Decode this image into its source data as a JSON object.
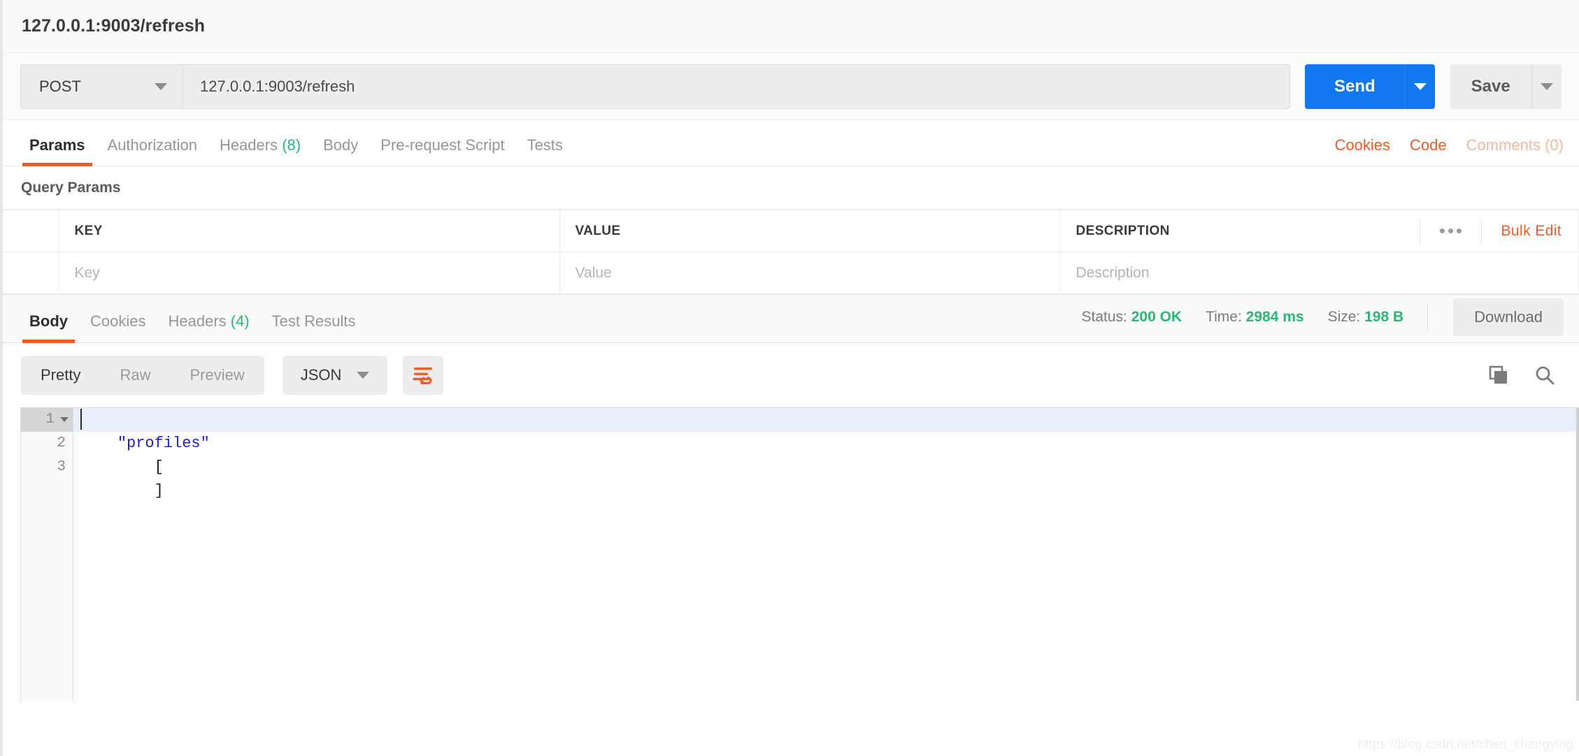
{
  "window": {
    "title": "127.0.0.1:9003/refresh"
  },
  "request_bar": {
    "method": "POST",
    "url": "127.0.0.1:9003/refresh",
    "send_label": "Send",
    "save_label": "Save"
  },
  "request_tabs": {
    "items": [
      {
        "label": "Params",
        "count": "",
        "active": true
      },
      {
        "label": "Authorization",
        "count": "",
        "active": false
      },
      {
        "label": "Headers",
        "count": "(8)",
        "active": false
      },
      {
        "label": "Body",
        "count": "",
        "active": false
      },
      {
        "label": "Pre-request Script",
        "count": "",
        "active": false
      },
      {
        "label": "Tests",
        "count": "",
        "active": false
      }
    ],
    "right_links": [
      {
        "label": "Cookies",
        "muted": false
      },
      {
        "label": "Code",
        "muted": false
      },
      {
        "label": "Comments (0)",
        "muted": true
      }
    ]
  },
  "query_params": {
    "section_title": "Query Params",
    "columns": [
      "KEY",
      "VALUE",
      "DESCRIPTION"
    ],
    "more_menu": "more-options",
    "bulk_edit_label": "Bulk Edit",
    "rows": [
      {
        "key_placeholder": "Key",
        "value_placeholder": "Value",
        "description_placeholder": "Description"
      }
    ]
  },
  "response_tabs": {
    "items": [
      {
        "label": "Body",
        "count": "",
        "active": true
      },
      {
        "label": "Cookies",
        "count": "",
        "active": false
      },
      {
        "label": "Headers",
        "count": "(4)",
        "active": false
      },
      {
        "label": "Test Results",
        "count": "",
        "active": false
      }
    ],
    "meta": {
      "status_label": "Status:",
      "status_value": "200 OK",
      "time_label": "Time:",
      "time_value": "2984 ms",
      "size_label": "Size:",
      "size_value": "198 B"
    },
    "download_label": "Download"
  },
  "body_toolbar": {
    "view_modes": [
      {
        "label": "Pretty",
        "active": true
      },
      {
        "label": "Raw",
        "active": false
      },
      {
        "label": "Preview",
        "active": false
      }
    ],
    "format": "JSON",
    "wrap_icon": "word-wrap-icon",
    "copy_icon": "copy-icon",
    "search_icon": "search-icon"
  },
  "response_body": {
    "language": "json",
    "lines": [
      {
        "number": "1",
        "text": "[",
        "type": "bracket",
        "highlighted": true,
        "foldable": true
      },
      {
        "number": "2",
        "text": "    \"profiles\"",
        "type": "string",
        "highlighted": false,
        "foldable": false
      },
      {
        "number": "3",
        "text": "]",
        "type": "bracket",
        "highlighted": false,
        "foldable": false
      }
    ],
    "line1": "[",
    "line2_indent": "    ",
    "line2_string": "\"profiles\"",
    "line3": "]"
  },
  "watermark": {
    "text": "https://blog.csdn.net/chen_changying"
  },
  "colors": {
    "accent_orange": "#ef5b25",
    "send_blue": "#1278f2",
    "status_green": "#2cb673",
    "string_blue": "#2020cf",
    "highlight_blue": "#e7effa"
  }
}
